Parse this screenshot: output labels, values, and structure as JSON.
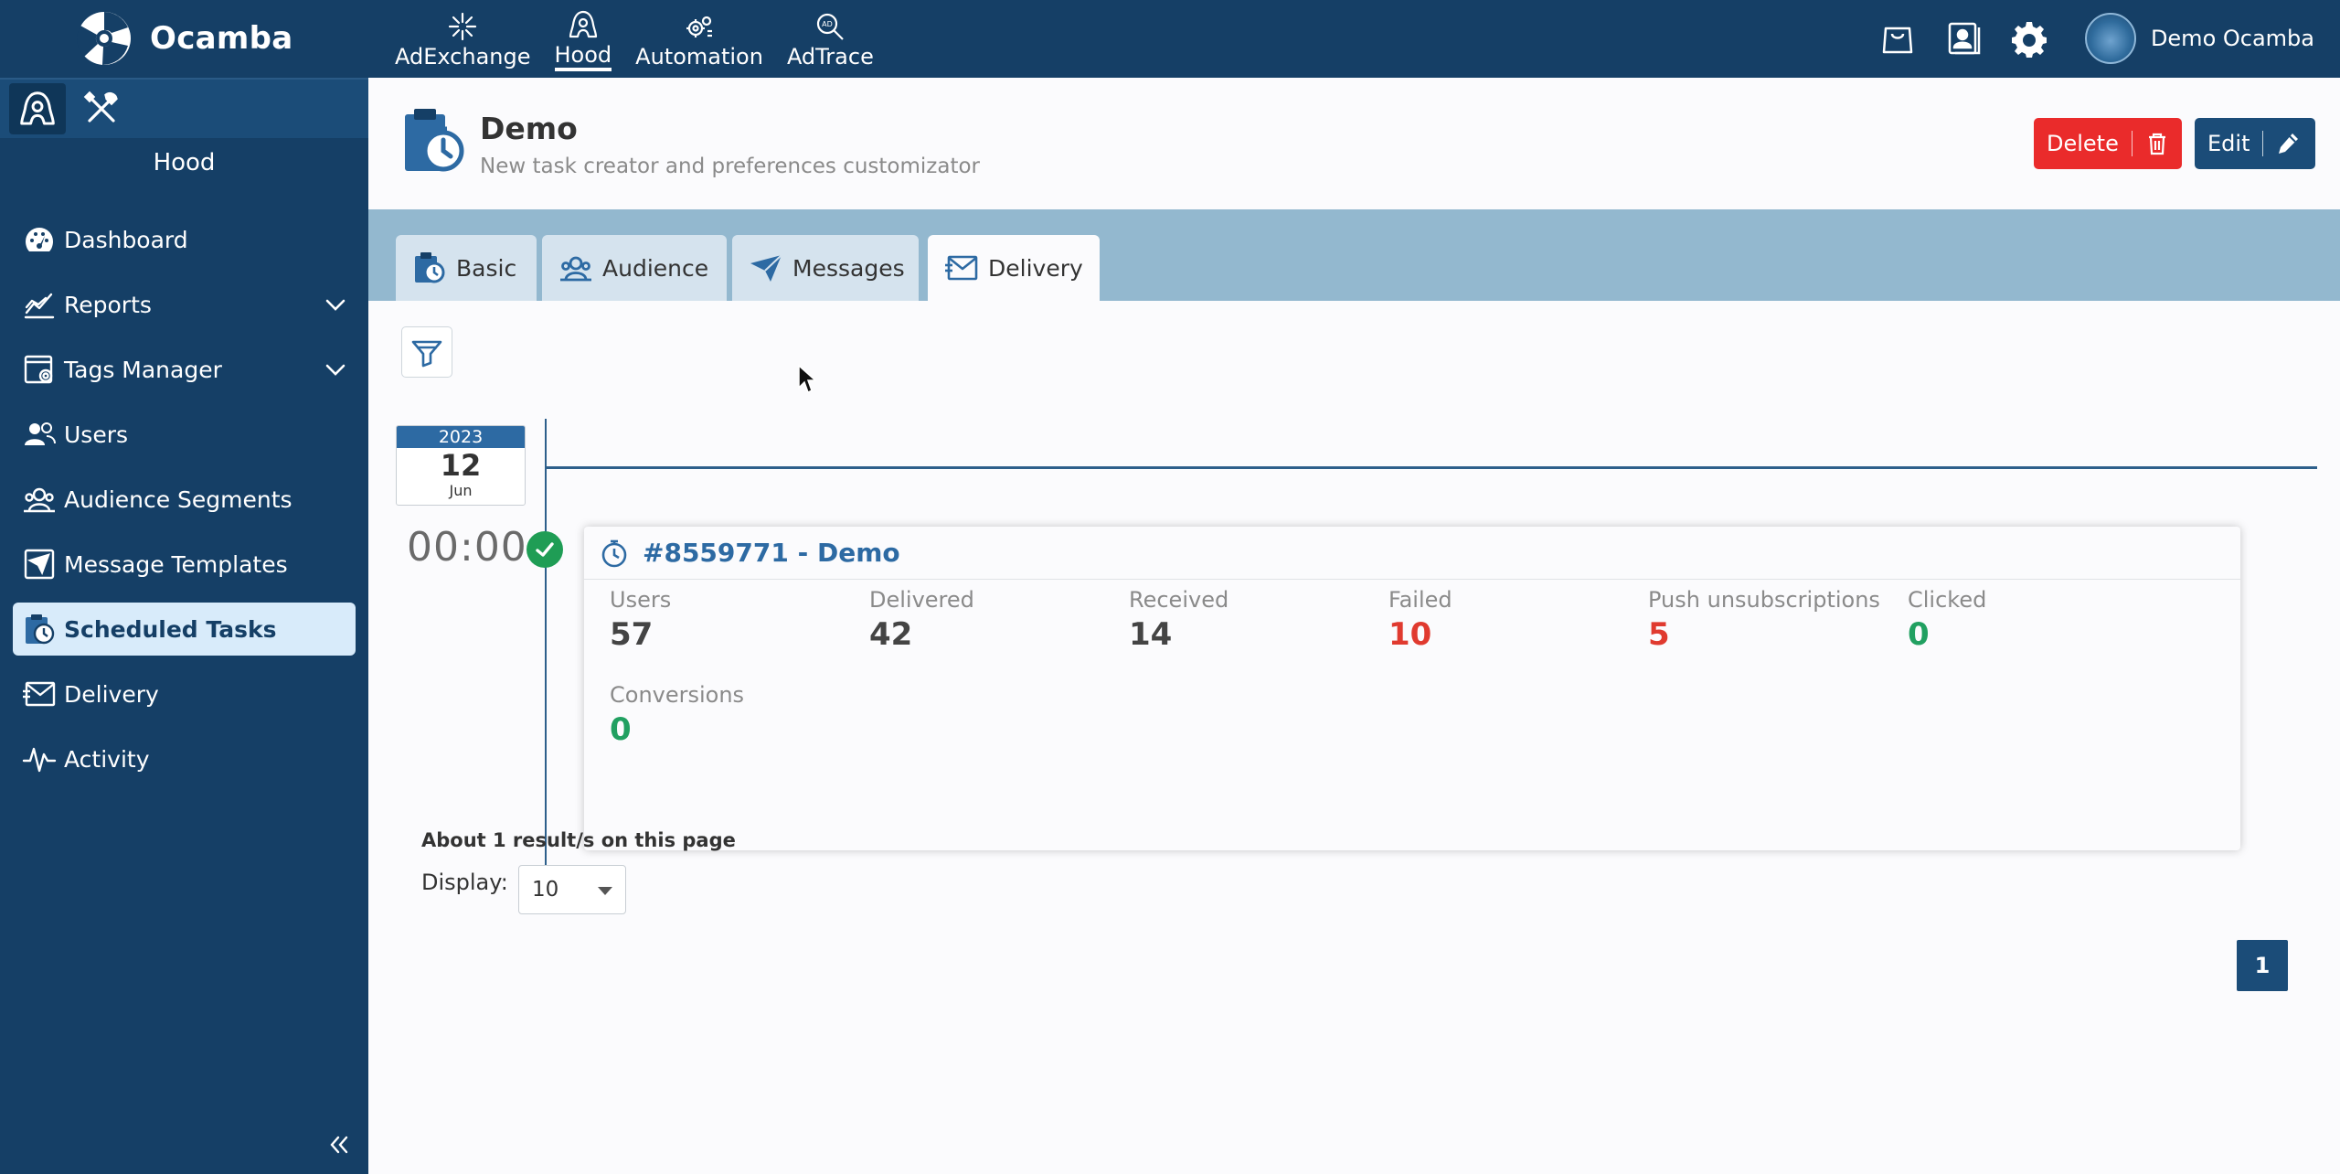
{
  "brand": {
    "name": "Ocamba"
  },
  "topnav": [
    {
      "label": "AdExchange",
      "icon": "sparkle-icon"
    },
    {
      "label": "Hood",
      "icon": "hood-icon",
      "active": true
    },
    {
      "label": "Automation",
      "icon": "gears-icon"
    },
    {
      "label": "AdTrace",
      "icon": "adtrace-search-icon"
    }
  ],
  "user": {
    "name": "Demo Ocamba"
  },
  "sidebar": {
    "title": "Hood",
    "items": [
      {
        "label": "Dashboard",
        "icon": "dashboard-icon"
      },
      {
        "label": "Reports",
        "icon": "chart-line-icon",
        "expandable": true
      },
      {
        "label": "Tags Manager",
        "icon": "tags-manager-icon",
        "expandable": true
      },
      {
        "label": "Users",
        "icon": "users-icon"
      },
      {
        "label": "Audience Segments",
        "icon": "audience-icon"
      },
      {
        "label": "Message Templates",
        "icon": "message-template-icon"
      },
      {
        "label": "Scheduled Tasks",
        "icon": "scheduled-task-icon",
        "active": true
      },
      {
        "label": "Delivery",
        "icon": "envelope-icon"
      },
      {
        "label": "Activity",
        "icon": "activity-pulse-icon"
      }
    ]
  },
  "page": {
    "title": "Demo",
    "subtitle": "New task creator and preferences customizator",
    "delete_label": "Delete",
    "edit_label": "Edit"
  },
  "tabs": [
    {
      "label": "Basic",
      "icon": "clipboard-clock-icon"
    },
    {
      "label": "Audience",
      "icon": "audience-icon"
    },
    {
      "label": "Messages",
      "icon": "paper-plane-icon"
    },
    {
      "label": "Delivery",
      "icon": "envelope-icon",
      "active": true
    }
  ],
  "timeline": {
    "date": {
      "year": "2023",
      "day": "12",
      "month": "Jun"
    },
    "time": "00:00",
    "task": {
      "title": "#8559771 - Demo",
      "stats": [
        {
          "label": "Users",
          "value": "57"
        },
        {
          "label": "Delivered",
          "value": "42"
        },
        {
          "label": "Received",
          "value": "14"
        },
        {
          "label": "Failed",
          "value": "10",
          "color": "#e03a2f"
        },
        {
          "label": "Push unsubscriptions",
          "value": "5",
          "color": "#e03a2f"
        },
        {
          "label": "Clicked",
          "value": "0",
          "color": "#21a061"
        },
        {
          "label": "Conversions",
          "value": "0",
          "color": "#21a061"
        }
      ]
    }
  },
  "pagination": {
    "results_text": "About 1  result/s on this page",
    "display_label": "Display:",
    "display_value": "10",
    "current_page": "1"
  },
  "colors": {
    "nav_bg": "#153f66",
    "accent": "#1b4c78",
    "tab_bar": "#93b8cf",
    "danger": "#ea2b2b",
    "success": "#21a061"
  }
}
